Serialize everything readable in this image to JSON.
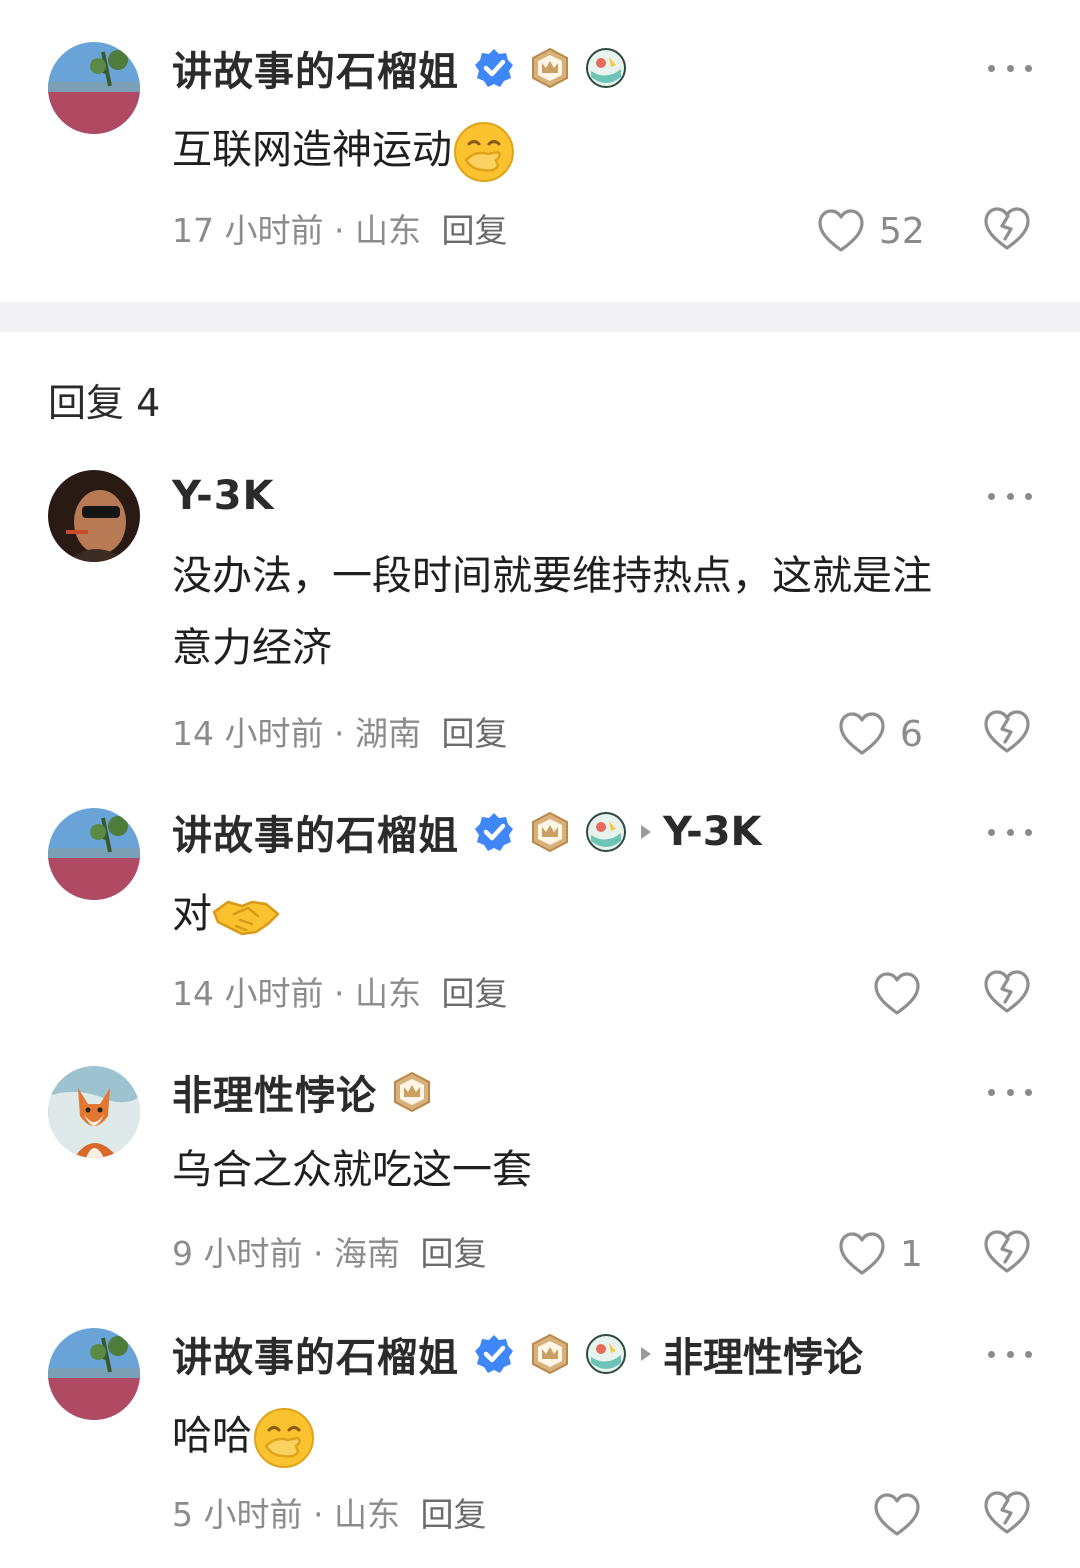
{
  "main_comment": {
    "user": "讲故事的石榴姐",
    "text": "互联网造神运动",
    "emoji": "hand-over-mouth-emoji",
    "time": "17 小时前",
    "location": "山东",
    "reply_label": "回复",
    "likes": "52"
  },
  "replies_header": "回复 4",
  "replies": [
    {
      "user": "Y-3K",
      "text_line1": "没办法，一段时间就要维持热点，这就是注",
      "text_line2": "意力经济",
      "time": "14 小时前",
      "location": "湖南",
      "reply_label": "回复",
      "likes": "6"
    },
    {
      "user": "讲故事的石榴姐",
      "reply_to": "Y-3K",
      "text": "对",
      "emoji": "handshake-emoji",
      "time": "14 小时前",
      "location": "山东",
      "reply_label": "回复",
      "likes": ""
    },
    {
      "user": "非理性悖论",
      "text": "乌合之众就吃这一套",
      "time": "9 小时前",
      "location": "海南",
      "reply_label": "回复",
      "likes": "1"
    },
    {
      "user": "讲故事的石榴姐",
      "reply_to": "非理性悖论",
      "text": "哈哈",
      "emoji": "hand-over-mouth-emoji",
      "time": "5 小时前",
      "location": "山东",
      "reply_label": "回复",
      "likes": ""
    }
  ],
  "meta_separator": "·",
  "colors": {
    "verified_blue": "#3f86f7",
    "crown_gold": "#c9a062",
    "text_primary": "#1f1f1f",
    "text_secondary": "#8c8c8c",
    "divider": "#f3f3f5"
  }
}
